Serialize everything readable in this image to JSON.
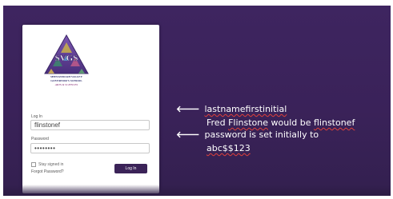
{
  "logo": {
    "monogram": "SVGS",
    "name_line1": "SHENANDOAH VALLEY",
    "name_line2": "GOVERNOR'S SCHOOL",
    "name_line3": "ARTS & SCIENCES"
  },
  "login_form": {
    "username_label": "Log In",
    "username_value": "flinstonef",
    "password_label": "Password",
    "password_value": "••••••••",
    "stay_signed_in_label": "Stay signed in",
    "forgot_password_label": "Forgot Password?",
    "login_button_label": "Log In"
  },
  "annotations": {
    "arrow_glyph": "🡐",
    "username_note": "lastnamefirstinitial",
    "example_prefix": "Fred ",
    "example_surname": "Flinstone",
    "example_mid": " would be ",
    "example_result": "flinstonef",
    "password_note": "password is set initially to",
    "default_password": "abc$$123"
  },
  "colors": {
    "background": "#3a2259",
    "card": "#ffffff",
    "button": "#3b2358",
    "spellcheck_underline": "#e0413a",
    "logo_triangle": "#5a3c8c"
  }
}
